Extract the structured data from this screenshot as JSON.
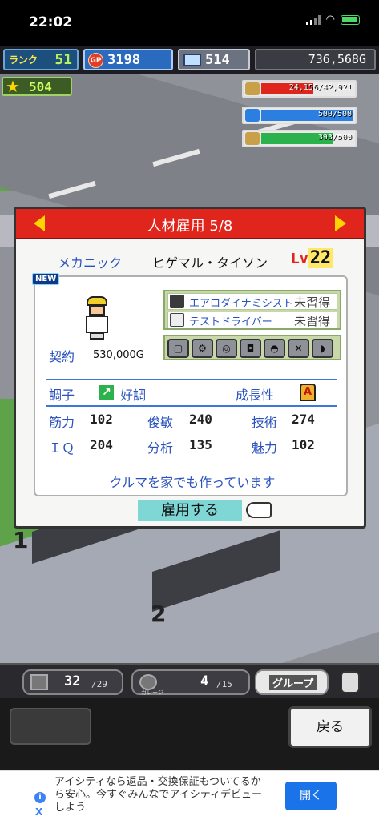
{
  "status_bar": {
    "time": "22:02"
  },
  "hud": {
    "rank_label": "ランク",
    "rank_value": "51",
    "gp_label": "GP",
    "gp_value": "3198",
    "pc_value": "514",
    "money": "736,568G",
    "stars": "504"
  },
  "resources": [
    {
      "name": "fuel",
      "text": "24,156/42,921",
      "color": "#e0261c",
      "fraction": 0.563
    },
    {
      "name": "oil",
      "text": "500/500",
      "color": "#2a7fe0",
      "fraction": 1.0
    },
    {
      "name": "food",
      "text": "393/500",
      "color": "#2bb24c",
      "fraction": 0.786
    }
  ],
  "dialog": {
    "title": "人材雇用 5/8",
    "job": "メカニック",
    "name": "ヒゲマル・タイソン",
    "level_label": "Lv",
    "level": "22",
    "new_badge": "NEW",
    "contract_label": "契約",
    "contract_value": "530,000G",
    "skills": [
      {
        "name": "エアロダイナミシスト",
        "state": "未習得"
      },
      {
        "name": "テストドライバー",
        "state": "未習得"
      }
    ],
    "condition_label": "調子",
    "condition_value": "好調",
    "growth_label": "成長性",
    "growth_grade": "A",
    "stats": [
      {
        "label": "筋力",
        "value": "102"
      },
      {
        "label": "俊敏",
        "value": "240"
      },
      {
        "label": "技術",
        "value": "274"
      },
      {
        "label": "ＩＱ",
        "value": "204"
      },
      {
        "label": "分析",
        "value": "135"
      },
      {
        "label": "魅力",
        "value": "102"
      }
    ],
    "comment": "クルマを家でも作っています",
    "hire_button": "雇用する"
  },
  "bottom_bar": {
    "tab1_value": "32",
    "tab1_total": "/29",
    "tab2_caption": "ガレージ",
    "tab2_value": "4",
    "tab2_total": "/15",
    "group_label": "グループ",
    "back_button": "戻る"
  },
  "ad": {
    "text": "アイシティなら返品・交換保証もついてるから安心。今すぐみんなでアイシティデビューしよう",
    "button": "開く",
    "info": "i",
    "close": "X"
  },
  "scene": {
    "marker1": "1",
    "marker2": "2"
  }
}
